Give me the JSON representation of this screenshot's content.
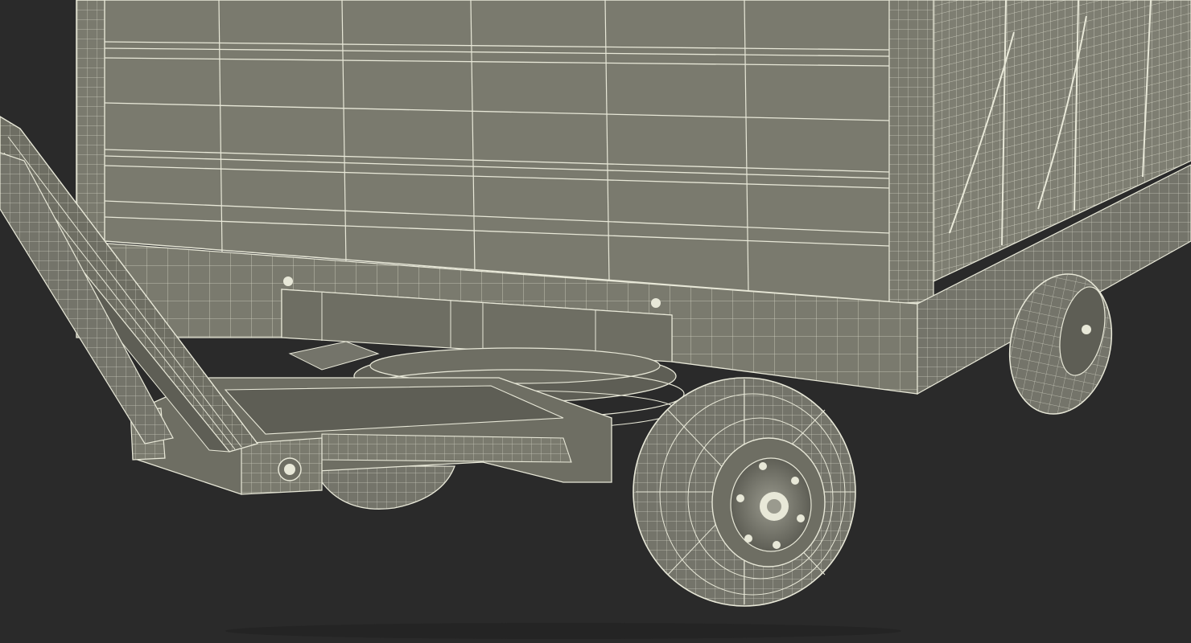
{
  "scene": {
    "subject": "wireframe-render",
    "colors": {
      "background": "#2a2a2a",
      "surface": "#7a7a6e",
      "surface_dark": "#5e5e55",
      "surface_light": "#8a8a7e",
      "wire": "#e8e8d8",
      "tire": "#74746a",
      "shadow": "#1e1e1e"
    }
  }
}
